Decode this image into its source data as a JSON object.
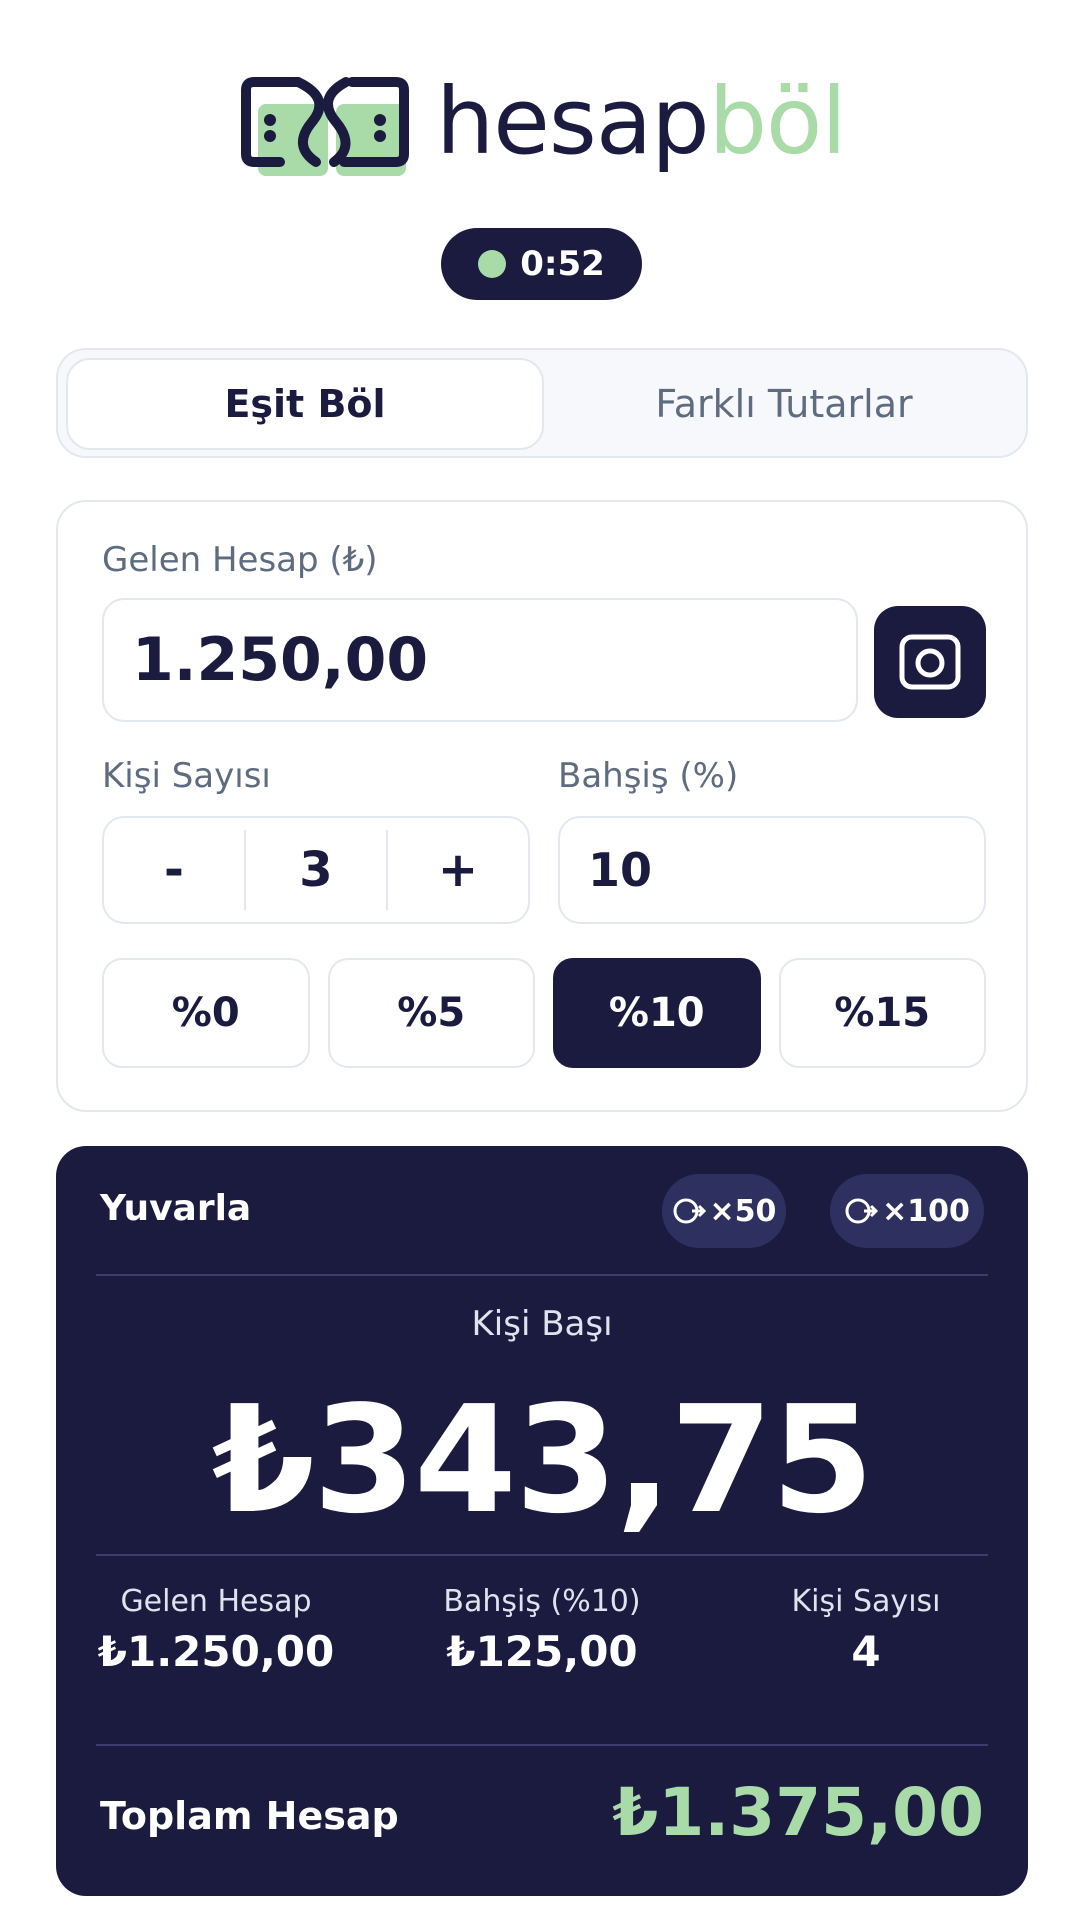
{
  "brand": {
    "name_part1": "hesap",
    "name_part2": "böl"
  },
  "timer": {
    "value": "0:52"
  },
  "tabs": [
    {
      "label": "Eşit Böl",
      "active": true
    },
    {
      "label": "Farklı Tutarlar",
      "active": false
    }
  ],
  "form": {
    "amount_label": "Gelen Hesap (₺)",
    "amount_value": "1.250,00",
    "people_label": "Kişi Sayısı",
    "people_decrement": "-",
    "people_value": "3",
    "people_increment": "+",
    "tip_label": "Bahşiş (%)",
    "tip_value": "10",
    "presets": [
      {
        "label": "%0",
        "active": false
      },
      {
        "label": "%5",
        "active": false
      },
      {
        "label": "%10",
        "active": true
      },
      {
        "label": "%15",
        "active": false
      }
    ]
  },
  "result": {
    "round_title": "Yuvarla",
    "round_options": [
      "×50",
      "×100"
    ],
    "per_person_label": "Kişi Başı",
    "per_person_value": "₺343,75",
    "stats": [
      {
        "label": "Gelen Hesap",
        "value": "₺1.250,00"
      },
      {
        "label": "Bahşiş (%10)",
        "value": "₺125,00"
      },
      {
        "label": "Kişi Sayısı",
        "value": "4"
      }
    ],
    "total_label": "Toplam Hesap",
    "total_value": "₺1.375,00"
  },
  "colors": {
    "navy": "#1a1b3f",
    "accent_green": "#a9dba8",
    "border": "#e3e8ef",
    "muted_text": "#5f6b7e"
  }
}
